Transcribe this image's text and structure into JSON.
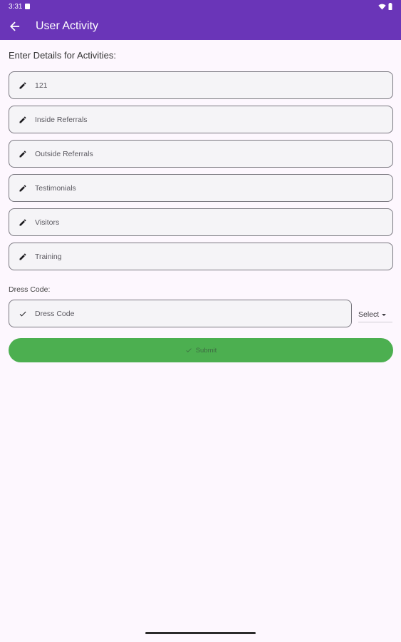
{
  "status_bar": {
    "time": "3:31"
  },
  "app_bar": {
    "title": "User Activity",
    "back_icon": "arrow-back-icon"
  },
  "form": {
    "section_label": "Enter Details for Activities:",
    "fields": [
      {
        "value": "121",
        "icon": "pencil-icon"
      },
      {
        "value": "Inside Referrals",
        "icon": "pencil-icon"
      },
      {
        "value": "Outside Referrals",
        "icon": "pencil-icon"
      },
      {
        "value": "Testimonials",
        "icon": "pencil-icon"
      },
      {
        "value": "Visitors",
        "icon": "pencil-icon"
      },
      {
        "value": "Training",
        "icon": "pencil-icon"
      }
    ],
    "dress_code": {
      "label": "Dress Code:",
      "field_value": "Dress Code",
      "icon": "check-icon",
      "select_label": "Select"
    },
    "submit_label": "Submit"
  },
  "colors": {
    "app_bar": "#6a35b8",
    "background": "#fdf7fe",
    "submit": "#4caf50"
  }
}
